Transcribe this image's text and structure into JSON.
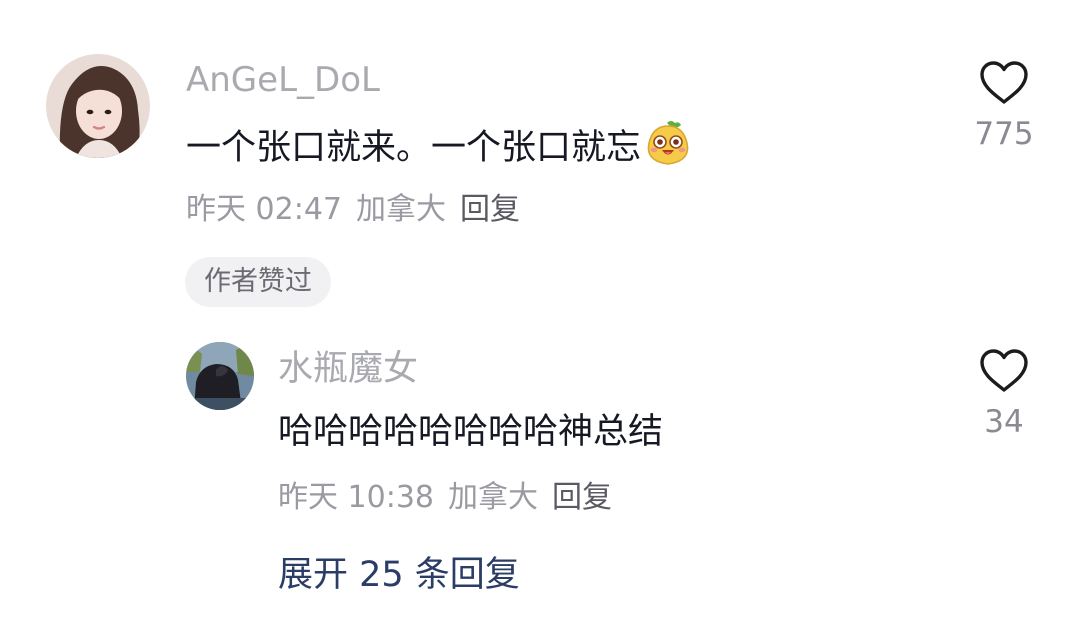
{
  "comment": {
    "username": "AnGeL_DoL",
    "text": "一个张口就来。一个张口就忘",
    "emoji_icon": "smiling-pear-emoji",
    "time": "昨天 02:47",
    "location": "加拿大",
    "reply_label": "回复",
    "author_liked_badge": "作者赞过",
    "like_icon": "heart-outline-icon",
    "like_count": "775"
  },
  "reply": {
    "username": "水瓶魔女",
    "text": "哈哈哈哈哈哈哈哈神总结",
    "time": "昨天 10:38",
    "location": "加拿大",
    "reply_label": "回复",
    "like_icon": "heart-outline-icon",
    "like_count": "34"
  },
  "expand_replies_label": "展开 25 条回复",
  "colors": {
    "username": "#a9a9b0",
    "body_text": "#161823",
    "meta_text": "#9a9aa2",
    "expand_link": "#2b3d66",
    "badge_bg": "#f1f1f3"
  }
}
